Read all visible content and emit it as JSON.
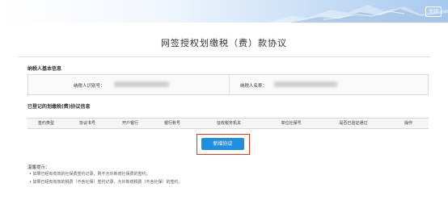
{
  "header": {
    "close_label": "关闭"
  },
  "page": {
    "title": "网签授权划缴税（费）款协议"
  },
  "basic_info": {
    "section_title": "纳税人基本信息",
    "taxpayer_id_label": "纳税人识别号：",
    "taxpayer_name_label": "纳税人名称："
  },
  "registered": {
    "section_title": "已登记的划缴税(费)协议信息",
    "columns": [
      "签约类型",
      "协议书号",
      "开户银行",
      "银行账号",
      "征收税务机关",
      "单位社保号",
      "是否已验证通过",
      "操作"
    ]
  },
  "actions": {
    "add_agreement_label": "新增协议"
  },
  "tips": {
    "title": "温馨提示：",
    "items": [
      "• 如果已经有有效的社保费签约记录，则不允许新增社保费的签约；",
      "• 如果已经有有效的税费（不含社保）签约记录，允许新增税费（不含社保）的签约。"
    ]
  },
  "colors": {
    "primary_button": "#1f8fe4",
    "highlight_frame": "#e8381c"
  }
}
